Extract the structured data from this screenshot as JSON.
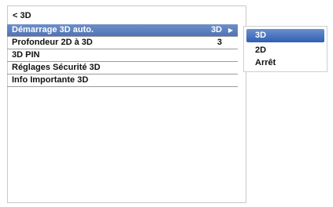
{
  "header": {
    "title": "< 3D"
  },
  "menu": {
    "items": [
      {
        "label": "Démarrage 3D auto.",
        "value": "3D",
        "arrow": "▶",
        "selected": true
      },
      {
        "label": "Profondeur 2D à 3D",
        "value": "3"
      },
      {
        "label": "3D PIN"
      },
      {
        "label": "Réglages Sécurité 3D"
      },
      {
        "label": "Info Importante 3D"
      }
    ]
  },
  "submenu": {
    "options": [
      "3D",
      "2D",
      "Arrêt"
    ],
    "selected": "3D"
  },
  "colors": {
    "selection_blue": "#4f74b5",
    "submenu_selection_blue": "#2f5fb4"
  }
}
